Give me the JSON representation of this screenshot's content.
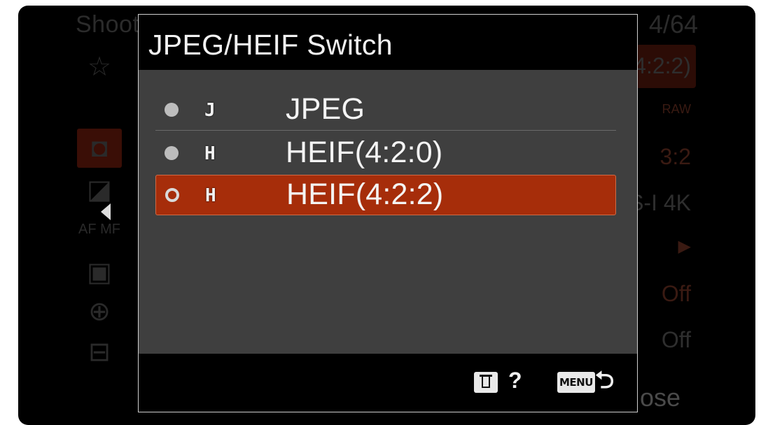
{
  "background_menu": {
    "title": "Shooti",
    "page": "4/64",
    "right_values": [
      "4:2:2)",
      "RAW",
      "3:2",
      "S-I 4K",
      "▶",
      "Off",
      "Off"
    ],
    "footer_text": "ose"
  },
  "dialog": {
    "title": "JPEG/HEIF Switch",
    "options": [
      {
        "letter": "J",
        "label": "JPEG",
        "selected": false
      },
      {
        "letter": "H",
        "label": "HEIF(4:2:0)",
        "selected": false
      },
      {
        "letter": "H",
        "label": "HEIF(4:2:2)",
        "selected": true
      }
    ],
    "footer": {
      "help_icon": "trash-icon",
      "help_label": "?",
      "menu_key": "MENU",
      "back_icon": "back-arrow-icon",
      "back_glyph": "⮌"
    }
  },
  "colors": {
    "selection": "#a62d0a",
    "dialog_body": "#3f3f3f",
    "header": "#000000"
  }
}
